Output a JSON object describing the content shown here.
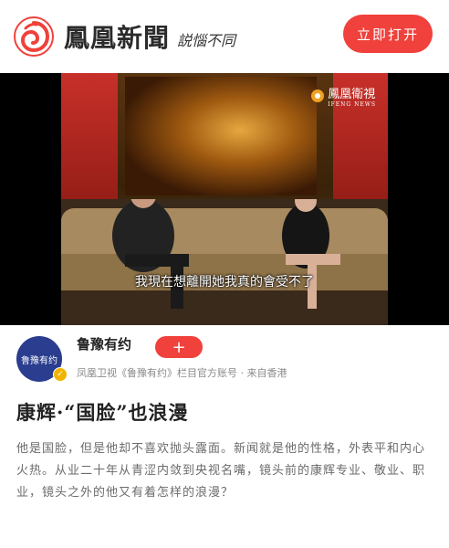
{
  "header": {
    "brand_name": "鳳凰新聞",
    "slogan": "説惱不同",
    "open_button_label": "立即打开",
    "brand_color": "#f0413c"
  },
  "video": {
    "watermark_text": "鳳凰衛視",
    "watermark_sub": "IFENG NEWS",
    "subtitle": "我現在想離開她我真的會受不了"
  },
  "author": {
    "avatar_text": "鲁豫有约",
    "name": "鲁豫有约",
    "follow_label": "+",
    "description": "凤凰卫视《鲁豫有约》栏目官方账号  · 来自香港"
  },
  "article": {
    "title": "康辉·“国脸”也浪漫",
    "body": "他是国脸，但是他却不喜欢抛头露面。新闻就是他的性格，外表平和内心火热。从业二十年从青涩内敛到央视名嘴，镜头前的康辉专业、敬业、职业，镜头之外的他又有着怎样的浪漫？"
  }
}
